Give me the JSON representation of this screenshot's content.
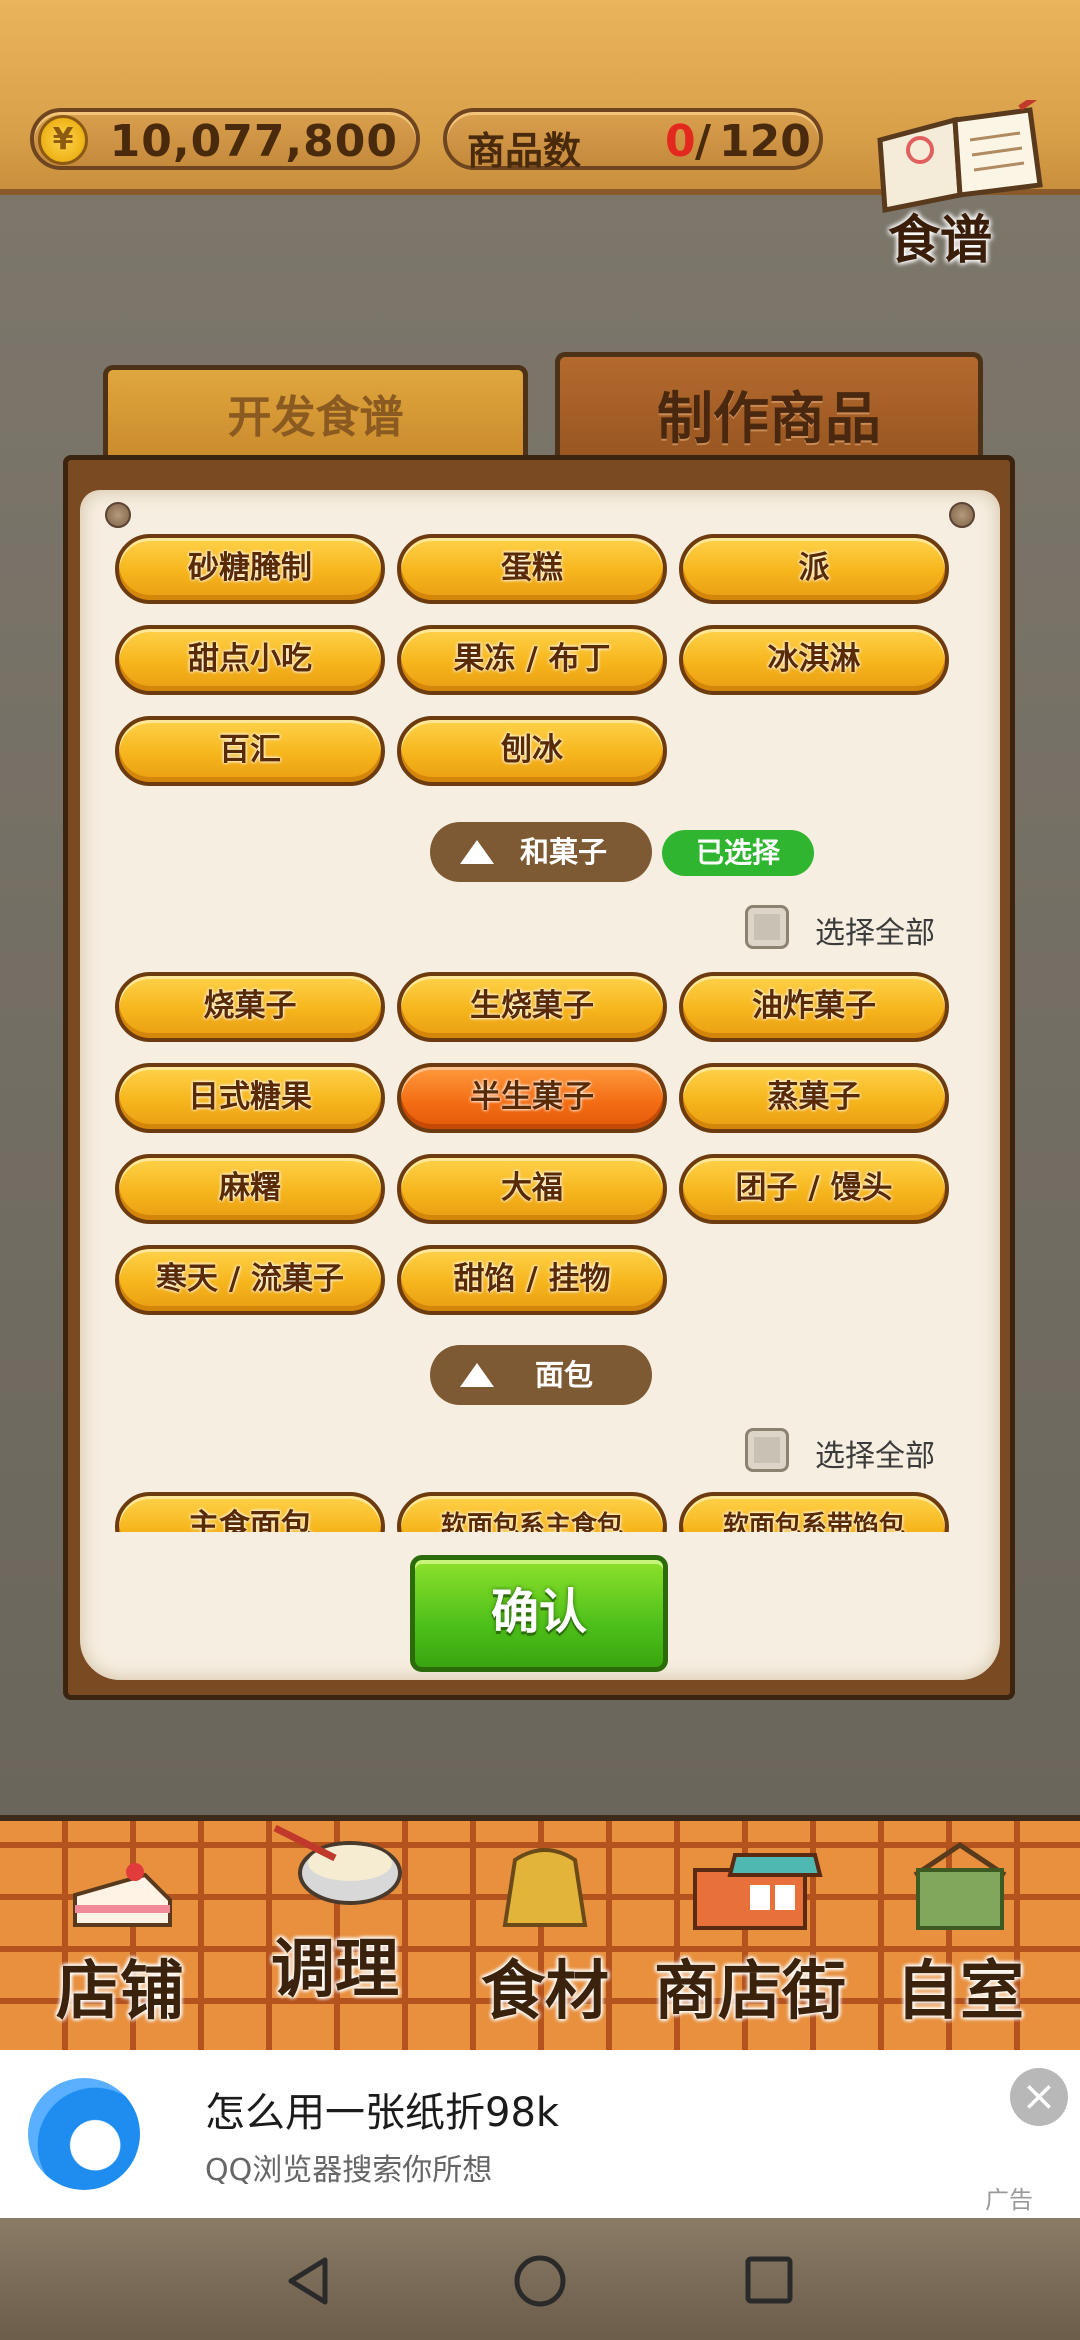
{
  "header": {
    "currency_symbol": "¥",
    "money": "10,077,800",
    "product_count_label": "商品数",
    "product_count_current": "0",
    "product_count_separator": "/",
    "product_count_max": "120",
    "recipe_book_label": "食谱"
  },
  "tabs": [
    {
      "label": "开发食谱",
      "active": false
    },
    {
      "label": "制作商品",
      "active": true
    }
  ],
  "western_sweets_rows": [
    [
      "砂糖腌制",
      "蛋糕",
      "派"
    ],
    [
      "甜点小吃",
      "果冻 / 布丁",
      "冰淇淋"
    ],
    [
      "百汇",
      "刨冰"
    ]
  ],
  "section_wagashi": {
    "title": "和菓子",
    "selected_badge": "已选择",
    "select_all": "选择全部",
    "rows": [
      [
        "烧菓子",
        "生烧菓子",
        "油炸菓子"
      ],
      [
        "日式糖果",
        "半生菓子",
        "蒸菓子"
      ],
      [
        "麻糬",
        "大福",
        "团子 / 馒头"
      ],
      [
        "寒天 / 流菓子",
        "甜馅 / 挂物"
      ]
    ],
    "selected_item": "半生菓子"
  },
  "section_bread": {
    "title": "面包",
    "select_all": "选择全部",
    "rows": [
      [
        "主食面包",
        "软面包系主食包",
        "软面包系带馅包"
      ]
    ]
  },
  "confirm_label": "确认",
  "bottom_nav": [
    {
      "label": "店铺",
      "icon": "cake-icon"
    },
    {
      "label": "调理",
      "icon": "mixing-bowl-icon"
    },
    {
      "label": "食材",
      "icon": "flour-sack-icon"
    },
    {
      "label": "商店街",
      "icon": "shop-icon"
    },
    {
      "label": "自室",
      "icon": "staff-only-icon"
    }
  ],
  "ad": {
    "title": "怎么用一张纸折98k",
    "subtitle": "QQ浏览器搜索你所想",
    "tag": "广告"
  },
  "colors": {
    "button_yellow": "#f6b51c",
    "button_selected": "#f36b12",
    "confirm_green": "#4ec01a",
    "badge_green": "#2fb530"
  }
}
